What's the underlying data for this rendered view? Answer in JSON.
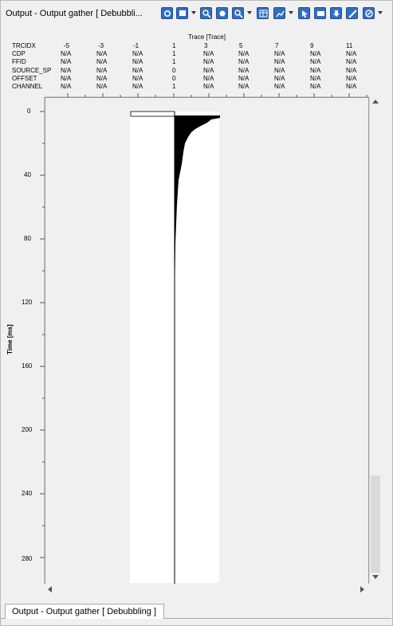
{
  "window": {
    "title": "Output - Output gather [ Debubbli..."
  },
  "toolbar": {
    "icons": [
      "settings-icon",
      "layout-icon",
      "zoom-in-icon",
      "zoom-fit-icon",
      "zoom-region-icon",
      "table-icon",
      "chart-icon",
      "pointer-icon",
      "comment-icon",
      "download-icon",
      "pen-icon",
      "compass-icon"
    ]
  },
  "header": {
    "axis_title": "Trace [Trace]",
    "row_labels": [
      "TRCIDX",
      "CDP",
      "FFID",
      "SOURCE_SP",
      "OFFSET",
      "CHANNEL"
    ],
    "columns": [
      {
        "trcidx": "-5",
        "cdp": "N/A",
        "ffid": "N/A",
        "src": "N/A",
        "offset": "N/A",
        "channel": "N/A"
      },
      {
        "trcidx": "-3",
        "cdp": "N/A",
        "ffid": "N/A",
        "src": "N/A",
        "offset": "N/A",
        "channel": "N/A"
      },
      {
        "trcidx": "-1",
        "cdp": "N/A",
        "ffid": "N/A",
        "src": "N/A",
        "offset": "N/A",
        "channel": "N/A"
      },
      {
        "trcidx": "1",
        "cdp": "1",
        "ffid": "1",
        "src": "0",
        "offset": "0",
        "channel": "1"
      },
      {
        "trcidx": "3",
        "cdp": "N/A",
        "ffid": "N/A",
        "src": "N/A",
        "offset": "N/A",
        "channel": "N/A"
      },
      {
        "trcidx": "5",
        "cdp": "N/A",
        "ffid": "N/A",
        "src": "N/A",
        "offset": "N/A",
        "channel": "N/A"
      },
      {
        "trcidx": "7",
        "cdp": "N/A",
        "ffid": "N/A",
        "src": "N/A",
        "offset": "N/A",
        "channel": "N/A"
      },
      {
        "trcidx": "9",
        "cdp": "N/A",
        "ffid": "N/A",
        "src": "N/A",
        "offset": "N/A",
        "channel": "N/A"
      },
      {
        "trcidx": "11",
        "cdp": "N/A",
        "ffid": "N/A",
        "src": "N/A",
        "offset": "N/A",
        "channel": "N/A"
      }
    ]
  },
  "yaxis": {
    "title": "Time [ms]",
    "ticks": [
      "0",
      "40",
      "80",
      "120",
      "160",
      "200",
      "240",
      "280"
    ]
  },
  "bottom_tab": {
    "label": "Output - Output gather [ Debubbling ]"
  }
}
